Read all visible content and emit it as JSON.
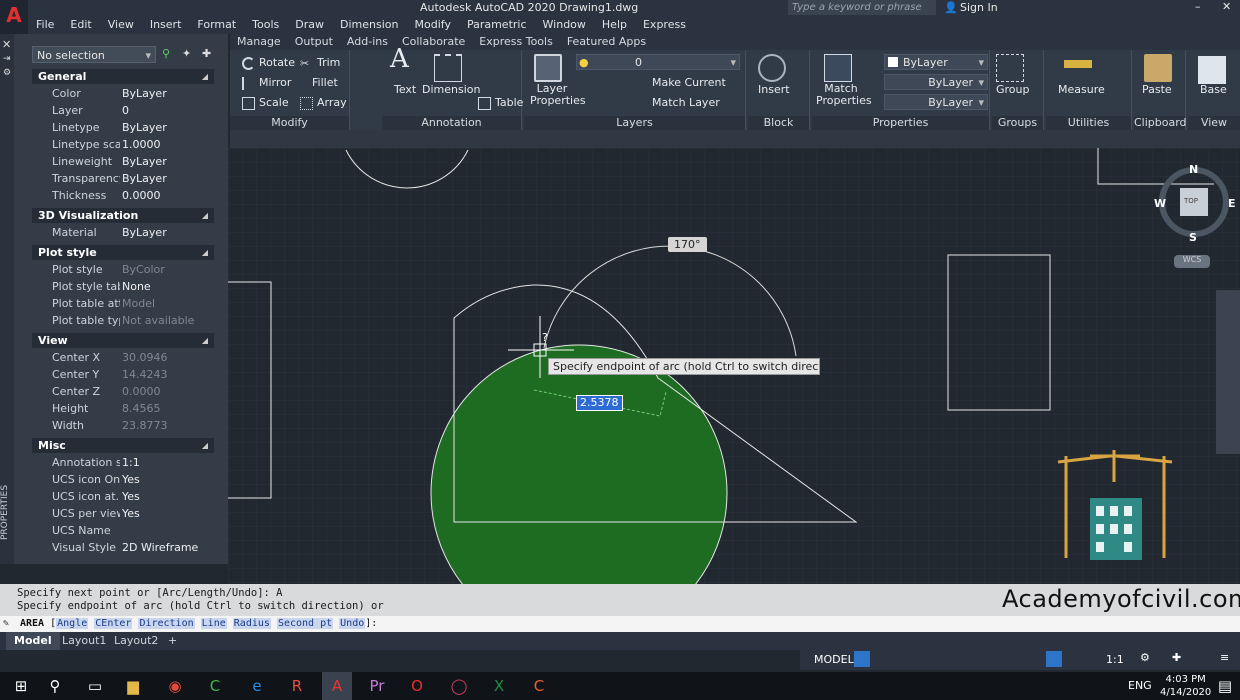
{
  "titlebar": {
    "title": "Autodesk AutoCAD 2020    Drawing1.dwg",
    "search_placeholder": "Type a keyword or phrase",
    "signin": "Sign In"
  },
  "menu": [
    "File",
    "Edit",
    "View",
    "Insert",
    "Format",
    "Tools",
    "Draw",
    "Dimension",
    "Modify",
    "Parametric",
    "Window",
    "Help",
    "Express"
  ],
  "ribbon_tabs": [
    "Manage",
    "Output",
    "Add-ins",
    "Collaborate",
    "Express Tools",
    "Featured Apps"
  ],
  "ribbon": {
    "modify": {
      "title": "Modify",
      "rotate": "Rotate",
      "trim": "Trim",
      "mirror": "Mirror",
      "fillet": "Fillet",
      "scale": "Scale",
      "array": "Array"
    },
    "annotation": {
      "title": "Annotation",
      "text": "Text",
      "dimension": "Dimension",
      "table": "Table"
    },
    "layers": {
      "title": "Layers",
      "layer_properties": "Layer Properties",
      "layer_value": "0",
      "make_current": "Make Current",
      "match_layer": "Match Layer"
    },
    "block": {
      "title": "Block",
      "insert": "Insert"
    },
    "properties": {
      "title": "Properties",
      "match_properties": "Match Properties",
      "color": "ByLayer",
      "linetype": "ByLayer",
      "lineweight": "ByLayer"
    },
    "groups": {
      "title": "Groups",
      "group": "Group"
    },
    "utilities": {
      "title": "Utilities",
      "measure": "Measure"
    },
    "clipboard": {
      "title": "Clipboard",
      "paste": "Paste"
    },
    "view": {
      "title": "View",
      "base": "Base"
    }
  },
  "properties_palette": {
    "selection": "No selection",
    "side_label": "PROPERTIES",
    "sections": [
      {
        "title": "General",
        "rows": [
          [
            "Color",
            "ByLayer"
          ],
          [
            "Layer",
            "0"
          ],
          [
            "Linetype",
            "ByLayer"
          ],
          [
            "Linetype scale",
            "1.0000"
          ],
          [
            "Lineweight",
            "ByLayer"
          ],
          [
            "Transparency",
            "ByLayer"
          ],
          [
            "Thickness",
            "0.0000"
          ]
        ]
      },
      {
        "title": "3D Visualization",
        "rows": [
          [
            "Material",
            "ByLayer"
          ]
        ]
      },
      {
        "title": "Plot style",
        "rows": [
          [
            "Plot style",
            "ByColor"
          ],
          [
            "Plot style table",
            "None"
          ],
          [
            "Plot table att...",
            "Model"
          ],
          [
            "Plot table type",
            "Not available"
          ]
        ]
      },
      {
        "title": "View",
        "rows": [
          [
            "Center X",
            "30.0946"
          ],
          [
            "Center Y",
            "14.4243"
          ],
          [
            "Center Z",
            "0.0000"
          ],
          [
            "Height",
            "8.4565"
          ],
          [
            "Width",
            "23.8773"
          ]
        ]
      },
      {
        "title": "Misc",
        "rows": [
          [
            "Annotation s...",
            "1:1"
          ],
          [
            "UCS icon On",
            "Yes"
          ],
          [
            "UCS icon at...",
            "Yes"
          ],
          [
            "UCS per view...",
            "Yes"
          ],
          [
            "UCS Name",
            ""
          ],
          [
            "Visual Style",
            "2D Wireframe"
          ]
        ]
      }
    ]
  },
  "drawing": {
    "angle_tip": "170°",
    "prompt": "Specify endpoint of arc (hold Ctrl to switch direction) or",
    "input_value": "2.5378",
    "cursor_mark": "?",
    "viewcube": {
      "n": "N",
      "s": "S",
      "e": "E",
      "w": "W",
      "top": "TOP",
      "wcs": "WCS"
    },
    "fill_color": "#1e6b22"
  },
  "command": {
    "history": [
      "Specify next point or [Arc/Length/Undo]: A",
      "Specify endpoint of arc (hold Ctrl to switch direction) or"
    ],
    "current": "AREA",
    "options": [
      "Angle",
      "CEnter",
      "Direction",
      "Line",
      "Radius",
      "Second pt",
      "Undo"
    ]
  },
  "watermark": "Academyofcivil.com",
  "layout_tabs": [
    "Model",
    "Layout1",
    "Layout2"
  ],
  "status": {
    "model": "MODEL",
    "scale": "1:1"
  },
  "clock": {
    "time": "4:03 PM",
    "date": "4/14/2020",
    "lang": "ENG"
  }
}
